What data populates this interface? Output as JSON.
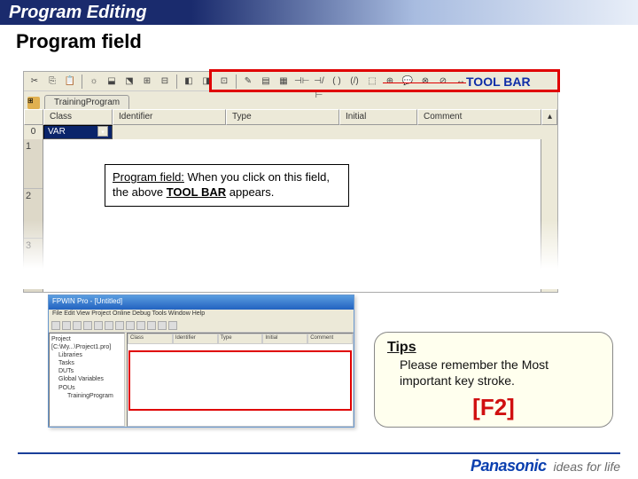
{
  "header": {
    "title": "Program Editing"
  },
  "subheading": "Program field",
  "toolbarLabel": "TOOL BAR",
  "tab": {
    "label": "TrainingProgram"
  },
  "columns": {
    "class": "Class",
    "identifier": "Identifier",
    "type": "Type",
    "initial": "Initial",
    "comment": "Comment"
  },
  "rows": {
    "r0": "0",
    "r0class": "VAR"
  },
  "lines": {
    "l1": "1",
    "l2": "2",
    "l3": "3"
  },
  "note": {
    "bold": "Program field:",
    "text": " When you click on this field, the above ",
    "u": "TOOL BAR",
    "tail": " appears."
  },
  "small": {
    "title": "FPWIN Pro - [Untitled]",
    "menu": "File  Edit  View  Project  Online  Debug  Tools  Window  Help",
    "tree": {
      "root": "Project [C:\\My...\\Project1.pro]",
      "n1": "Libraries",
      "n2": "Tasks",
      "n3": "DUTs",
      "n4": "Global Variables",
      "n5": "POUs",
      "n6": "TrainingProgram"
    },
    "cols": {
      "c1": "Class",
      "c2": "Identifier",
      "c3": "Type",
      "c4": "Initial",
      "c5": "Comment"
    }
  },
  "tips": {
    "title": "Tips",
    "text": "Please remember the Most important key stroke.",
    "key": "[F2]"
  },
  "footer": {
    "brand": "Panasonic",
    "tag": "ideas for life"
  }
}
